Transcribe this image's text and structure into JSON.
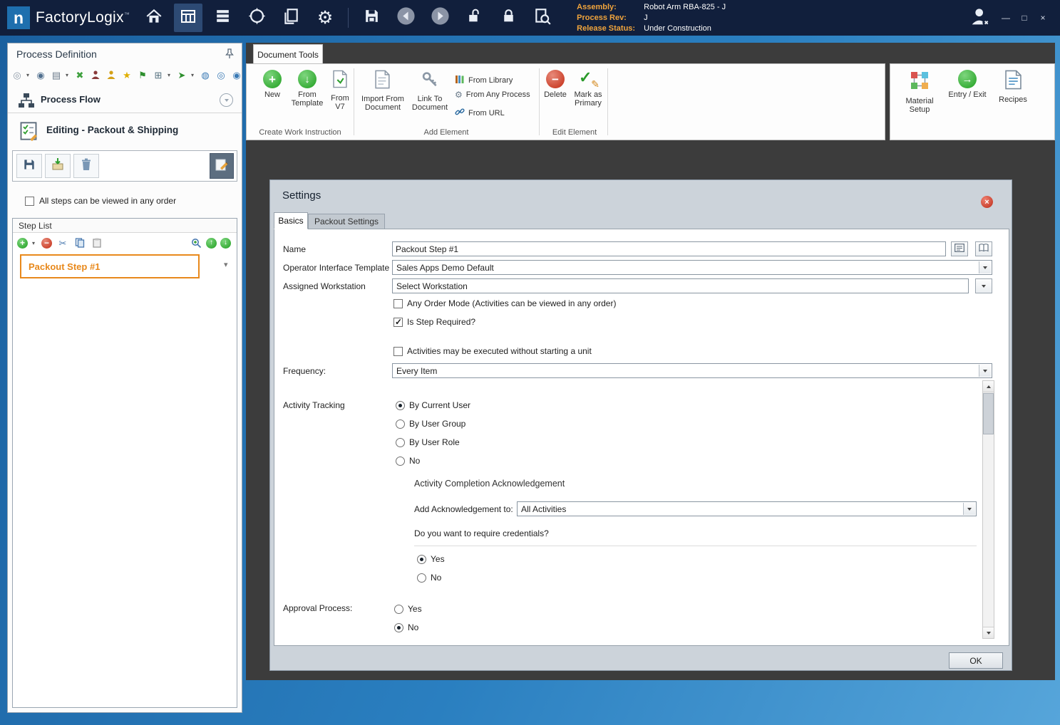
{
  "icons": {
    "dropdown": "▾",
    "plus": "+",
    "minus": "−",
    "scissors": "✂",
    "gear": "⚙",
    "star": "★",
    "flag": "⚑",
    "check": "✓",
    "x_mark": "✖",
    "arrow_up": "↑",
    "arrow_down": "↓",
    "arrow_right": "→",
    "play": "➤",
    "tree": "⊞",
    "disc": "◍",
    "ring": "◎",
    "target": "◉",
    "pencil": "✎",
    "page": "▤",
    "minimize": "—",
    "maximize": "□",
    "close": "×"
  },
  "titlebar": {
    "logo_letter": "n",
    "app_name": "FactoryLogix",
    "trademark": "™",
    "assembly_label": "Assembly:",
    "assembly_value": "Robot Arm RBA-825 - J",
    "process_rev_label": "Process Rev:",
    "process_rev_value": "J",
    "release_status_label": "Release Status:",
    "release_status_value": "Under Construction"
  },
  "left_panel": {
    "title": "Process Definition",
    "process_flow_label": "Process Flow",
    "editing_label": "Editing - Packout & Shipping",
    "order_checkbox_label": "All steps can be viewed in any order",
    "step_list_title": "Step List",
    "step_1_label": "Packout Step #1"
  },
  "ribbon": {
    "tab_label": "Document Tools",
    "create_group": {
      "label": "Create Work Instruction",
      "new": "New",
      "from_template": "From Template",
      "from_v7": "From V7"
    },
    "add_group": {
      "label": "Add Element",
      "import_doc": "Import From Document",
      "link_doc": "Link To Document",
      "from_library": "From Library",
      "from_any_process": "From Any Process",
      "from_url": "From URL"
    },
    "edit_group": {
      "label": "Edit Element",
      "delete": "Delete",
      "mark_primary": "Mark as Primary"
    },
    "tools": {
      "material_setup": "Material Setup",
      "entry_exit": "Entry / Exit",
      "recipes": "Recipes"
    }
  },
  "dialog": {
    "title": "Settings",
    "tab_basics": "Basics",
    "tab_packout": "Packout Settings",
    "name_label": "Name",
    "name_value": "Packout Step #1",
    "oit_label": "Operator Interface Template",
    "oit_value": "Sales Apps Demo Default",
    "workstation_label": "Assigned Workstation",
    "workstation_value": "Select Workstation",
    "any_order_label": "Any Order Mode (Activities can be viewed in any order)",
    "step_required_label": "Is Step Required?",
    "no_unit_label": "Activities may be executed without starting a unit",
    "frequency_label": "Frequency:",
    "frequency_value": "Every Item",
    "tracking_label": "Activity Tracking",
    "track_current": "By Current User",
    "track_group": "By User Group",
    "track_role": "By User Role",
    "track_no": "No",
    "ack_heading": "Activity Completion Acknowledgement",
    "ack_label": "Add Acknowledgement to:",
    "ack_value": "All Activities",
    "credentials_question": "Do you want to require credentials?",
    "cred_yes": "Yes",
    "cred_no": "No",
    "approval_label": "Approval Process:",
    "appr_yes": "Yes",
    "appr_no": "No",
    "ok_label": "OK"
  },
  "states": {
    "left_order_checked": false,
    "any_order_checked": false,
    "step_required_checked": true,
    "no_unit_checked": false,
    "track_current": true,
    "track_group": false,
    "track_role": false,
    "track_no": false,
    "cred_yes": true,
    "cred_no": false,
    "appr_yes": false,
    "appr_no": true
  }
}
